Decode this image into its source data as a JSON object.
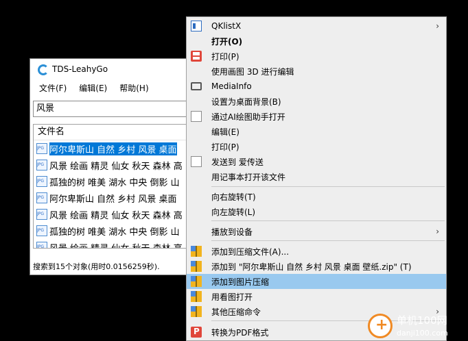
{
  "window": {
    "title": "TDS-LeahyGo",
    "menu": [
      "文件(F)",
      "编辑(E)",
      "帮助(H)"
    ],
    "search_value": "风景",
    "list_header": "文件名",
    "files": [
      "阿尔卑斯山 自然 乡村 风景 桌面",
      "风景 绘画 精灵 仙女 秋天 森林 高",
      "孤独的树 唯美 湖水 中央 倒影 山",
      "阿尔卑斯山 自然 乡村 风景 桌面",
      "风景 绘画 精灵 仙女 秋天 森林 高",
      "孤独的树 唯美 湖水 中央 倒影 山",
      "风景 绘画 精灵 仙女 秋天 森林 高"
    ],
    "status": "搜索到15个对象(用时0.0156259秒)."
  },
  "context_menu": {
    "items": [
      {
        "label": "QKlistX",
        "icon": "list-icon",
        "submenu": true
      },
      {
        "label": "打开(O)",
        "bold": true
      },
      {
        "label": "打印(P)",
        "icon": "printer-icon"
      },
      {
        "label": "使用画图 3D 进行编辑"
      },
      {
        "label": "MediaInfo",
        "icon": "mediainfo-icon"
      },
      {
        "label": "设置为桌面背景(B)"
      },
      {
        "label": "通过AI绘图助手打开",
        "icon": "document-icon"
      },
      {
        "label": "编辑(E)"
      },
      {
        "label": "打印(P)"
      },
      {
        "label": "发送到 爱传送",
        "icon": "document-icon"
      },
      {
        "label": "用记事本打开该文件"
      },
      {
        "label": "向右旋转(T)"
      },
      {
        "label": "向左旋转(L)"
      },
      {
        "label": "播放到设备",
        "submenu": true
      },
      {
        "label": "添加到压缩文件(A)...",
        "icon": "archive-icon"
      },
      {
        "label": "添加到 \"阿尔卑斯山 自然 乡村 风景 桌面 壁纸.zip\" (T)",
        "icon": "archive-icon"
      },
      {
        "label": "添加到图片压缩",
        "icon": "archive-icon",
        "highlighted": true
      },
      {
        "label": "用看图打开",
        "icon": "archive-icon"
      },
      {
        "label": "其他压缩命令",
        "icon": "archive-icon",
        "submenu": true
      },
      {
        "label": "转换为PDF格式",
        "icon": "pdf-icon"
      }
    ]
  },
  "watermark": {
    "text": "单机100网",
    "url": "danji100.com"
  }
}
